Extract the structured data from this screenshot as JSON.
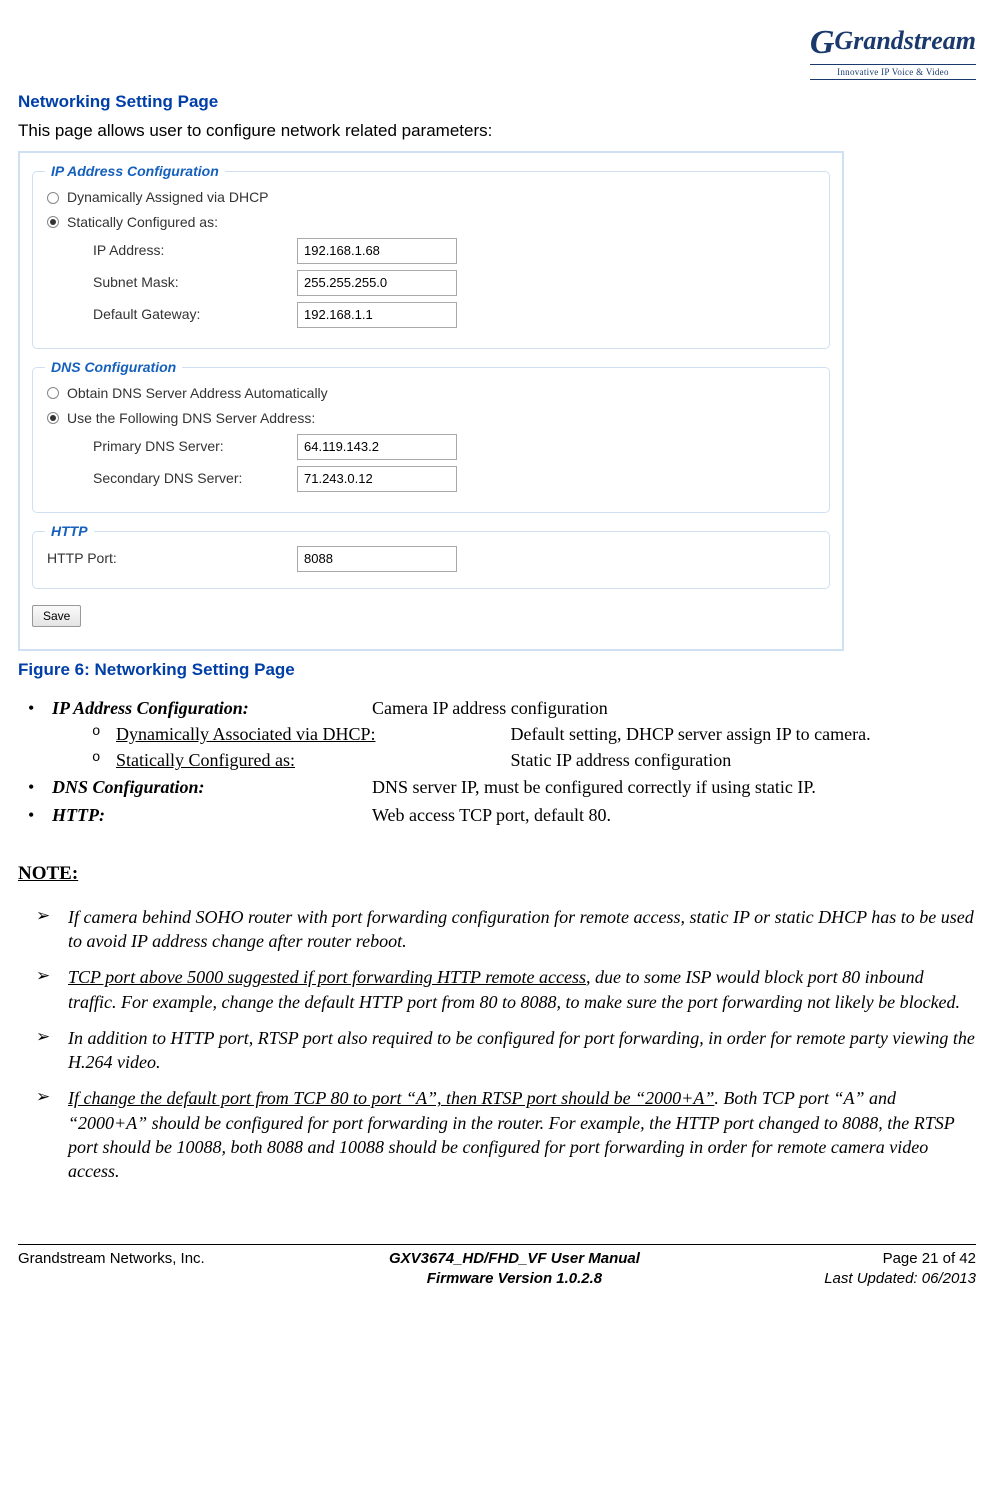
{
  "logo": {
    "name": "Grandstream",
    "tag": "Innovative IP Voice & Video"
  },
  "heading": "Networking Setting Page",
  "intro": "This page allows user to configure network related parameters:",
  "shot": {
    "ip": {
      "legend": "IP Address Configuration",
      "opt_dhcp": "Dynamically Assigned via DHCP",
      "opt_static": "Statically Configured as:",
      "ip_label": "IP Address:",
      "ip_val": "192.168.1.68",
      "mask_label": "Subnet Mask:",
      "mask_val": "255.255.255.0",
      "gw_label": "Default Gateway:",
      "gw_val": "192.168.1.1"
    },
    "dns": {
      "legend": "DNS Configuration",
      "opt_auto": "Obtain DNS Server Address Automatically",
      "opt_manual": "Use the Following DNS Server Address:",
      "p_label": "Primary DNS Server:",
      "p_val": "64.119.143.2",
      "s_label": "Secondary DNS Server:",
      "s_val": "71.243.0.12"
    },
    "http": {
      "legend": "HTTP",
      "port_label": "HTTP Port:",
      "port_val": "8088"
    },
    "save": "Save"
  },
  "caption": "Figure 6:  Networking Setting Page",
  "list": {
    "ip_label": "IP Address Configuration:",
    "ip_desc": "Camera IP address configuration",
    "dhcp_label": "Dynamically Associated via DHCP:",
    "dhcp_desc": "Default setting, DHCP server assign IP to camera.",
    "static_label": "Statically Configured as: ",
    "static_desc": "Static IP address configuration",
    "dns_label": "DNS Configuration:",
    "dns_desc": "DNS server IP, must be configured correctly if using static IP.",
    "http_label": "HTTP:",
    "http_desc": "Web access TCP port, default 80."
  },
  "note_h": "NOTE:",
  "notes": {
    "n1": "If camera behind SOHO router with port forwarding configuration for remote access, static IP or static DHCP has to be used to avoid IP address change after router reboot.",
    "n2a": "TCP port above 5000 suggested if port forwarding HTTP remote access",
    "n2b": ", due to some ISP would block port 80 inbound traffic. For example, change the default HTTP port from 80 to 8088, to make sure the port forwarding not likely be blocked.",
    "n3": "In addition to HTTP port, RTSP port also required to be configured for port forwarding, in order for remote party viewing the H.264 video.",
    "n4a": "If change the default port from TCP 80 to port “A”, then RTSP port should be “2000+A”",
    "n4b": ". Both TCP port “A” and “2000+A” should be configured for port forwarding in the router. For example, the HTTP port changed to 8088, the RTSP port should be 10088, both 8088 and 10088 should be configured for port forwarding in order for remote camera video access."
  },
  "footer": {
    "company": "Grandstream Networks, Inc.",
    "manual": "GXV3674_HD/FHD_VF User Manual",
    "page": "Page 21 of 42",
    "fw": "Firmware Version 1.0.2.8",
    "updated": "Last Updated: 06/2013"
  }
}
